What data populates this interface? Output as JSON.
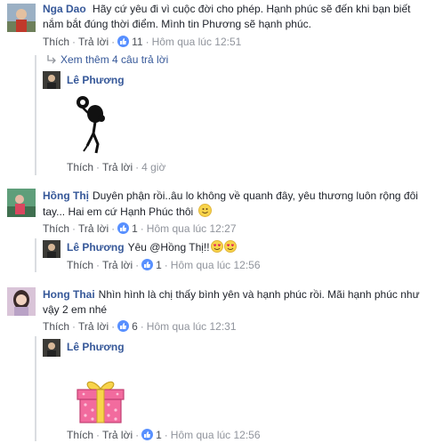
{
  "comments": [
    {
      "author": "Nga Dao",
      "text": "Hãy cứ yêu đi vì cuộc đời cho phép. Hạnh phúc sẽ đến khi bạn biết nắm bắt đúng thời điểm. Mình tin Phương sẽ hạnh phúc.",
      "actions": {
        "like": "Thích",
        "reply": "Trả lời",
        "reactions": "11",
        "time": "Hôm qua lúc 12:51"
      },
      "more_replies": "Xem thêm 4 câu trả lời",
      "reply": {
        "author": "Lê Phương",
        "sticker": "dancing-figure-sticker",
        "actions": {
          "like": "Thích",
          "reply": "Trả lời",
          "time": "4 giờ"
        }
      }
    },
    {
      "author": "Hồng Thị",
      "text_line1": "Duyên phận rồi..âu lo không về quanh đây, yêu thương luôn rộng đôi",
      "text_line2": "tay... Hai em cứ Hạnh Phúc thôi",
      "actions": {
        "like": "Thích",
        "reply": "Trả lời",
        "reactions": "1",
        "time": "Hôm qua lúc 12:27"
      },
      "reply": {
        "author": "Lê Phương",
        "text": "Yêu @Hồng Thị!!",
        "actions": {
          "like": "Thích",
          "reply": "Trả lời",
          "reactions": "1",
          "time": "Hôm qua lúc 12:56"
        }
      }
    },
    {
      "author": "Hong Thai",
      "text_line1": "Nhìn hình là chị thấy bình yên và hạnh phúc rồi. Mãi hạnh phúc như",
      "text_line2": "vậy 2 em nhé",
      "actions": {
        "like": "Thích",
        "reply": "Trả lời",
        "reactions": "6",
        "time": "Hôm qua lúc 12:31"
      },
      "reply": {
        "author": "Lê Phương",
        "sticker": "gift-box-sticker",
        "actions": {
          "like": "Thích",
          "reply": "Trả lời",
          "reactions": "1",
          "time": "Hôm qua lúc 12:56"
        }
      }
    }
  ],
  "colors": {
    "link": "#365899",
    "meta": "#90949c",
    "like_badge": "#5890ff",
    "gift_pink": "#f26b9e",
    "gift_ribbon": "#f8d44a"
  }
}
